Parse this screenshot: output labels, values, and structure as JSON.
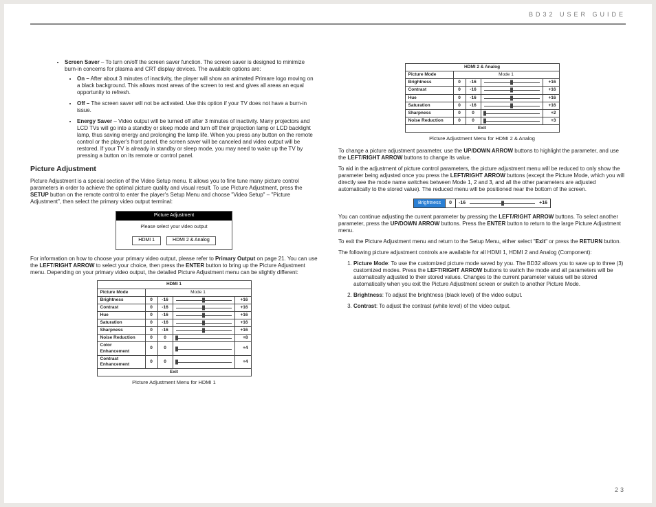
{
  "header": {
    "doc_title": "BD32 USER GUIDE",
    "page_number": "23"
  },
  "left": {
    "bullets": {
      "screen_saver": {
        "lead": "Screen Saver",
        "text": " – To turn on/off the screen saver function.  The screen saver is designed to minimize burn-in concerns for plasma and CRT display devices.  The available options are:",
        "sub": [
          {
            "lead": "On –",
            "text": " After about 3 minutes of inactivity, the player will show an animated Primare logo moving on a black background.  This allows most areas of the screen to rest and gives all areas an equal opportunity to refresh."
          },
          {
            "lead": "Off –",
            "text": " The screen saver will not be activated.  Use this option if your TV does not have a burn-in issue."
          },
          {
            "lead": "Energy Saver",
            "text": " – Video output will be turned off after 3 minutes of inactivity.  Many projectors and LCD TVs will go into a standby or sleep mode and turn off their projection lamp or LCD backlight lamp, thus saving energy and prolonging the lamp life.  When you press any button on the remote control or the player's front panel, the screen saver will be canceled and video output will be restored.  If your TV is already in standby or sleep mode, you may need to wake up the TV by pressing a button on its remote or control panel."
          }
        ]
      }
    },
    "section": "Picture Adjustment",
    "p1_a": "Picture Adjustment is a special section of the Video Setup menu.  It allows you to fine tune many picture control parameters in order to achieve the optimal picture quality and visual result.  To use Picture Adjustment, press the ",
    "p1_setup": "SETUP",
    "p1_b": " button on the remote control to enter the player's Setup Menu and choose \"Video Setup\" – \"Picture Adjustment\", then select the primary video output terminal:",
    "dialog": {
      "title": "Picture Adjustment",
      "prompt": "Please select your video output",
      "btn1": "HDMI 1",
      "btn2": "HDMI 2 & Analog"
    },
    "p2_a": "For information on how to choose your primary video output, please refer to ",
    "p2_primary": "Primary Output",
    "p2_b": " on page 21. You can use the ",
    "p2_lr": "LEFT/RIGHT ARROW",
    "p2_c": " to select your choice, then press the ",
    "p2_enter": "ENTER",
    "p2_d": " button to bring up the Picture Adjustment menu. Depending on your primary video output, the detailed Picture Adjustment menu can be slightly different:",
    "menu1": {
      "title": "HDMI 1",
      "mode_label": "Picture Mode",
      "mode_value": "Mode 1",
      "rows": [
        {
          "label": "Brightness",
          "c0": "0",
          "min": "-16",
          "max": "+16",
          "pos": 50
        },
        {
          "label": "Contrast",
          "c0": "0",
          "min": "-16",
          "max": "+16",
          "pos": 50
        },
        {
          "label": "Hue",
          "c0": "0",
          "min": "-16",
          "max": "+16",
          "pos": 50
        },
        {
          "label": "Saturation",
          "c0": "0",
          "min": "-16",
          "max": "+16",
          "pos": 50
        },
        {
          "label": "Sharpness",
          "c0": "0",
          "min": "-16",
          "max": "+16",
          "pos": 50
        },
        {
          "label": "Noise Reduction",
          "c0": "0",
          "min": "0",
          "max": "+8",
          "pos": 6
        },
        {
          "label": "Color Enhancement",
          "c0": "0",
          "min": "0",
          "max": "+4",
          "pos": 6
        },
        {
          "label": "Contrast Enhancement",
          "c0": "0",
          "min": "0",
          "max": "+4",
          "pos": 6
        }
      ],
      "exit": "Exit"
    },
    "caption1": "Picture Adjustment Menu for HDMI 1"
  },
  "right": {
    "menu2": {
      "title": "HDMI 2 & Analog",
      "mode_label": "Picture Mode",
      "mode_value": "Mode 1",
      "rows": [
        {
          "label": "Brightness",
          "c0": "0",
          "min": "-16",
          "max": "+16",
          "pos": 50
        },
        {
          "label": "Contrast",
          "c0": "0",
          "min": "-16",
          "max": "+16",
          "pos": 50
        },
        {
          "label": "Hue",
          "c0": "0",
          "min": "-16",
          "max": "+16",
          "pos": 50
        },
        {
          "label": "Saturation",
          "c0": "0",
          "min": "-16",
          "max": "+16",
          "pos": 50
        },
        {
          "label": "Sharpness",
          "c0": "0",
          "min": "0",
          "max": "+2",
          "pos": 6
        },
        {
          "label": "Noise Reduction",
          "c0": "0",
          "min": "0",
          "max": "+3",
          "pos": 6
        }
      ],
      "exit": "Exit"
    },
    "caption2": "Picture Adjustment Menu for HDMI 2 & Analog",
    "p3_a": "To change a picture adjustment parameter, use the ",
    "p3_ud": "UP/DOWN ARROW",
    "p3_b": " buttons to highlight the parameter, and use the ",
    "p3_lr": "LEFT/RIGHT ARROW",
    "p3_c": " buttons to change its value.",
    "p4_a": "To aid in the adjustment of picture control parameters, the picture adjustment menu will be reduced to only show the parameter being adjusted once you press the ",
    "p4_lr": "LEFT/RIGHT ARROW",
    "p4_b": " buttons (except the Picture Mode, which you will directly see the mode name switches between Mode 1, 2 and 3, and all the other parameters are adjusted automatically to the stored value).  The reduced menu will be positioned near the bottom of the screen.",
    "mini": {
      "label": "Brightness",
      "c0": "0",
      "min": "-16",
      "max": "+16"
    },
    "p5_a": "You can continue adjusting the current parameter by pressing the ",
    "p5_lr": "LEFT/RIGHT ARROW",
    "p5_b": " buttons.  To select another parameter, press the ",
    "p5_ud": "UP/DOWN ARROW",
    "p5_c": " buttons.  Press the ",
    "p5_enter": "ENTER",
    "p5_d": " button to return to the large Picture Adjustment menu.",
    "p6_a": "To exit the Picture Adjustment menu and return to the Setup Menu, either select \"",
    "p6_exit": "Exit",
    "p6_b": "\" or press the ",
    "p6_return": "RETURN",
    "p6_c": " button.",
    "p7": "The following picture adjustment controls are available for all HDMI 1, HDMI 2 and Analog (Component):",
    "ol": [
      {
        "lead": "Picture Mode",
        "text_a": ": To use the customized picture mode saved by you. The BD32 allows you to save up to three (3) customized modes. Press the ",
        "lr": "LEFT/RIGHT ARROW",
        "text_b": " buttons to switch the mode and all parameters will be automatically adjusted to their stored values.  Changes to the current parameter values will be stored automatically when you exit the Picture Adjustment screen or switch to another Picture Mode."
      },
      {
        "lead": "Brightness",
        "text_a": ": To adjust the brightness (black level) of the video output."
      },
      {
        "lead": "Contrast",
        "text_a": ": To adjust the contrast (white level) of the video output."
      }
    ]
  }
}
